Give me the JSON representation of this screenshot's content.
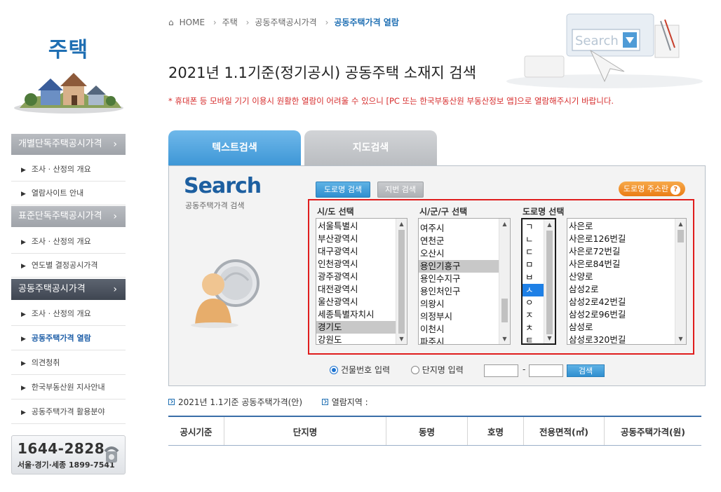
{
  "sidebar": {
    "title": "주택",
    "menu": [
      {
        "type": "head",
        "label": "개별단독주택공시가격",
        "arrow": "›"
      },
      {
        "type": "sub",
        "label": "조사 · 산정의 개요"
      },
      {
        "type": "sub",
        "label": "열람사이트 안내"
      },
      {
        "type": "head",
        "label": "표준단독주택공시가격",
        "arrow": "›"
      },
      {
        "type": "sub",
        "label": "조사 · 산정의 개요"
      },
      {
        "type": "sub",
        "label": "연도별 결정공시가격"
      },
      {
        "type": "head-dark",
        "label": "공동주택공시가격",
        "arrow": "›"
      },
      {
        "type": "sub",
        "label": "조사 · 산정의 개요"
      },
      {
        "type": "sub-active",
        "label": "공동주택가격 열람"
      },
      {
        "type": "sub",
        "label": "의견청취"
      },
      {
        "type": "sub",
        "label": "한국부동산원 지사안내"
      },
      {
        "type": "sub",
        "label": "공동주택가격 활용분야"
      }
    ],
    "phone_main": "1644-2828",
    "phone_sub": "서울·경기·세종 1899-7541"
  },
  "breadcrumb": [
    "HOME",
    "주택",
    "공동주택공시가격",
    "공동주택가격 열람"
  ],
  "breadcrumb_sep": "›",
  "page_title": "2021년 1.1기준(정기공시) 공동주택 소재지 검색",
  "notice": "* 휴대폰 등 모바일 기기 이용시 원활한 열람이 어려울 수 있으니 [PC 또는 한국부동산원 부동산정보 앱]으로 열람해주시기 바랍니다.",
  "header_illustration_text": "Search",
  "tabs": {
    "text": "텍스트검색",
    "map": "지도검색"
  },
  "search": {
    "logo": "Search",
    "subtitle": "공동주택가격 검색",
    "btn_road": "도로명 검색",
    "btn_lot": "지번 검색",
    "btn_help": "도로명 주소란",
    "help_glyph": "?",
    "label_sido": "시/도 선택",
    "label_sigungu": "시/군/구 선택",
    "label_road": "도로명 선택",
    "sido": [
      "서울특별시",
      "부산광역시",
      "대구광역시",
      "인천광역시",
      "광주광역시",
      "대전광역시",
      "울산광역시",
      "세종특별자치시",
      "경기도",
      "강원도"
    ],
    "sido_selected": 8,
    "sigungu": [
      "여주시",
      "연천군",
      "오산시",
      "용인기흥구",
      "용인수지구",
      "용인처인구",
      "의왕시",
      "의정부시",
      "이천시",
      "파주시"
    ],
    "sigungu_selected": 3,
    "initials": [
      "ㄱ",
      "ㄴ",
      "ㄷ",
      "ㅁ",
      "ㅂ",
      "ㅅ",
      "ㅇ",
      "ㅈ",
      "ㅊ",
      "ㅌ"
    ],
    "initials_selected": 5,
    "roads": [
      "사은로",
      "사은로126번길",
      "사은로72번길",
      "사은로84번길",
      "산양로",
      "삼성2로",
      "삼성2로42번길",
      "삼성2로96번길",
      "삼성로",
      "삼성로320번길"
    ],
    "radio_building": "건물번호 입력",
    "radio_complex": "단지명 입력",
    "range_sep": "-",
    "btn_search": "검색"
  },
  "results": {
    "info1": "2021년 1.1기준 공동주택가격(안)",
    "info2": "열람지역 :",
    "columns": [
      "공시기준",
      "단지명",
      "동명",
      "호명",
      "전용면적(㎡)",
      "공동주택가격(원)"
    ]
  }
}
